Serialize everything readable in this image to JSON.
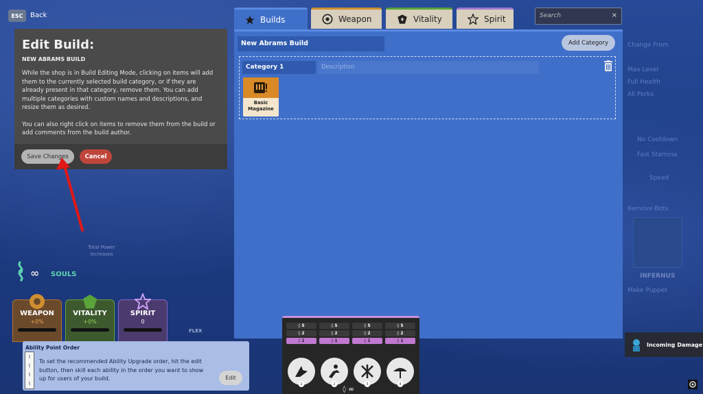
{
  "topbar": {
    "esc_key": "ESC",
    "back_label": "Back"
  },
  "edit_build": {
    "title": "Edit Build:",
    "subtitle": "NEW ABRAMS BUILD",
    "paragraph1": "While the shop is in Build Editing Mode, clicking on items will add them to the currently selected build category, or if they are already present in that category, remove them. You can add multiple categories with custom names and descriptions, and resize them as desired.",
    "paragraph2": "You can also right click on items to remove them from the build or add comments from the build author.",
    "save_label": "Save Changes",
    "cancel_label": "Cancel"
  },
  "left_faded": {
    "text": "Total Power Increases"
  },
  "souls": {
    "symbol": "∞",
    "label": "SOULS"
  },
  "stats": [
    {
      "name": "WEAPON",
      "value": "+0%",
      "color": "#d08f2f"
    },
    {
      "name": "VITALITY",
      "value": "+0%",
      "color": "#5aa43a"
    },
    {
      "name": "SPIRIT",
      "value": "0",
      "color": "#a07ad0"
    }
  ],
  "flex_label": "FLEX",
  "ability_point_order": {
    "title": "Ability Point Order",
    "description": "To set the recommended Ability Upgrade order, hit the edit button, then skill each ability in the order you want to show up for users of your build.",
    "edit_label": "Edit"
  },
  "tabs": [
    {
      "label": "Builds",
      "icon": "star-icon",
      "active": true
    },
    {
      "label": "Weapon",
      "icon": "weapon-icon",
      "active": false
    },
    {
      "label": "Vitality",
      "icon": "vitality-icon",
      "active": false
    },
    {
      "label": "Spirit",
      "icon": "spirit-icon",
      "active": false
    }
  ],
  "search": {
    "placeholder": "Search",
    "clear": "×"
  },
  "build": {
    "name": "New Abrams Build",
    "add_category_label": "Add Category",
    "category": {
      "name": "Category 1",
      "description_placeholder": "Description",
      "items": [
        {
          "name": "Basic Magazine",
          "color": "#d98a27"
        }
      ]
    }
  },
  "right_faded": {
    "lines": [
      "Change From",
      "Max Level",
      "Full Health",
      "All Perks",
      "No Cooldown",
      "Fast Stamina",
      "Speed",
      "Remove Bots",
      "Make Puppet"
    ],
    "hero_name": "INFERNUS"
  },
  "incoming_damage": "Incoming Damage",
  "ability_order_grid": [
    [
      "◊ 5",
      "◊ 2",
      "◊ 1"
    ],
    [
      "◊ 5",
      "◊ 2",
      "◊ 1"
    ],
    [
      "◊ 5",
      "◊ 2",
      "◊ 1"
    ],
    [
      "◊ 5",
      "◊ 2",
      "◊ 1"
    ]
  ],
  "ability_numbers": [
    "1",
    "2",
    "3",
    "4"
  ],
  "ability_infinity": "◊ ∞"
}
